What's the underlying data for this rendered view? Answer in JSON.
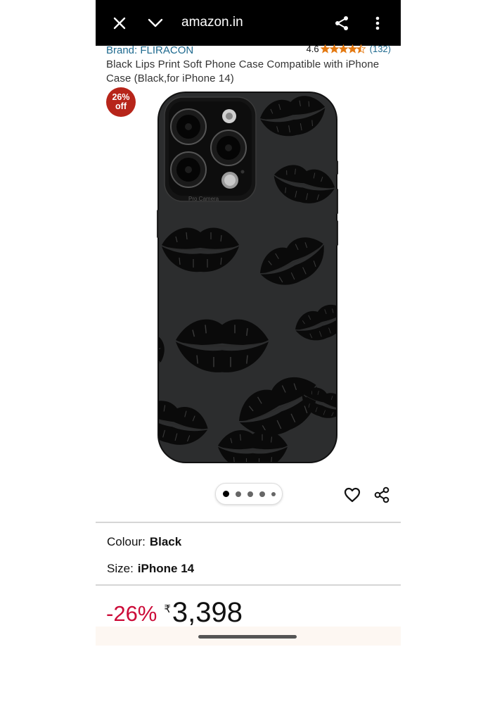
{
  "browser": {
    "url": "amazon.in",
    "icons": [
      "close-icon",
      "chevron-down-icon",
      "share-icon",
      "more-vertical-icon"
    ]
  },
  "product": {
    "brand": "Brand: FLIRACON",
    "rating_value": "4.6",
    "rating_stars": 4.5,
    "rating_count": "(132)",
    "title": "Black Lips Print Soft Phone Case Compatible with iPhone Case (Black,for iPhone 14)",
    "badge_line1": "26%",
    "badge_line2": "off",
    "image_lens_text": "Pro Camera",
    "carousel": {
      "total": 5,
      "active": 0
    }
  },
  "options": {
    "colour_label": "Colour:",
    "colour_value": "Black",
    "size_label": "Size:",
    "size_value": "iPhone 14"
  },
  "price": {
    "discount": "-26%",
    "currency": "₹",
    "amount": "3,398"
  },
  "colors": {
    "brand_link": "#1f6a8f",
    "star": "#e47911",
    "badge": "#b7251a",
    "discount": "#cc0c39"
  }
}
